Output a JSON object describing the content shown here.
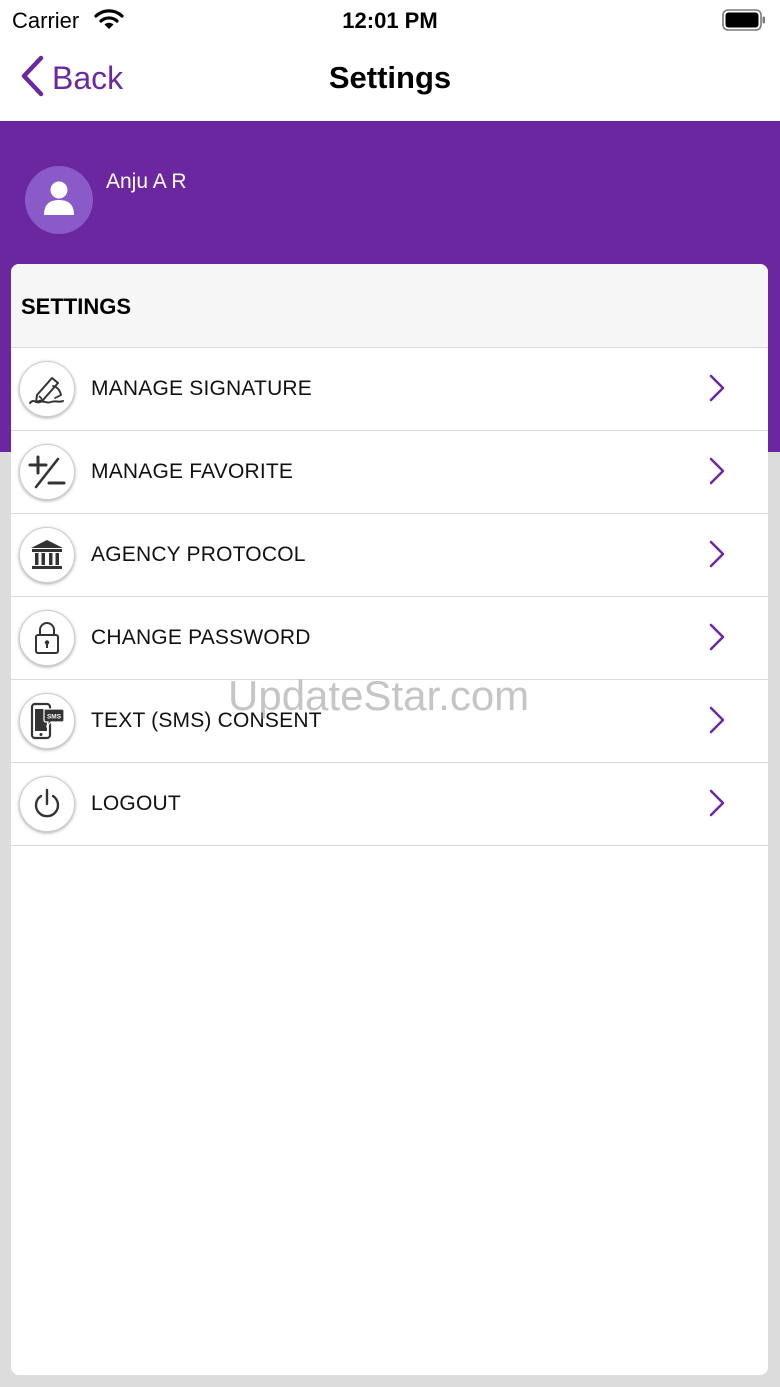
{
  "status_bar": {
    "carrier": "Carrier",
    "time": "12:01 PM"
  },
  "nav": {
    "back_label": "Back",
    "title": "Settings"
  },
  "profile": {
    "name": "Anju A R"
  },
  "settings": {
    "section_title": "SETTINGS",
    "items": [
      {
        "label": "MANAGE SIGNATURE",
        "icon": "signature-icon"
      },
      {
        "label": "MANAGE FAVORITE",
        "icon": "plus-minus-icon"
      },
      {
        "label": "AGENCY PROTOCOL",
        "icon": "bank-building-icon"
      },
      {
        "label": "CHANGE PASSWORD",
        "icon": "lock-icon"
      },
      {
        "label": "TEXT (SMS) CONSENT",
        "icon": "sms-phone-icon"
      },
      {
        "label": "LOGOUT",
        "icon": "power-icon"
      }
    ]
  },
  "watermark": "UpdateStar.com",
  "colors": {
    "brand_purple": "#6a27a0",
    "avatar_purple": "#8a5ac8",
    "back_purple": "#6a29a0"
  }
}
